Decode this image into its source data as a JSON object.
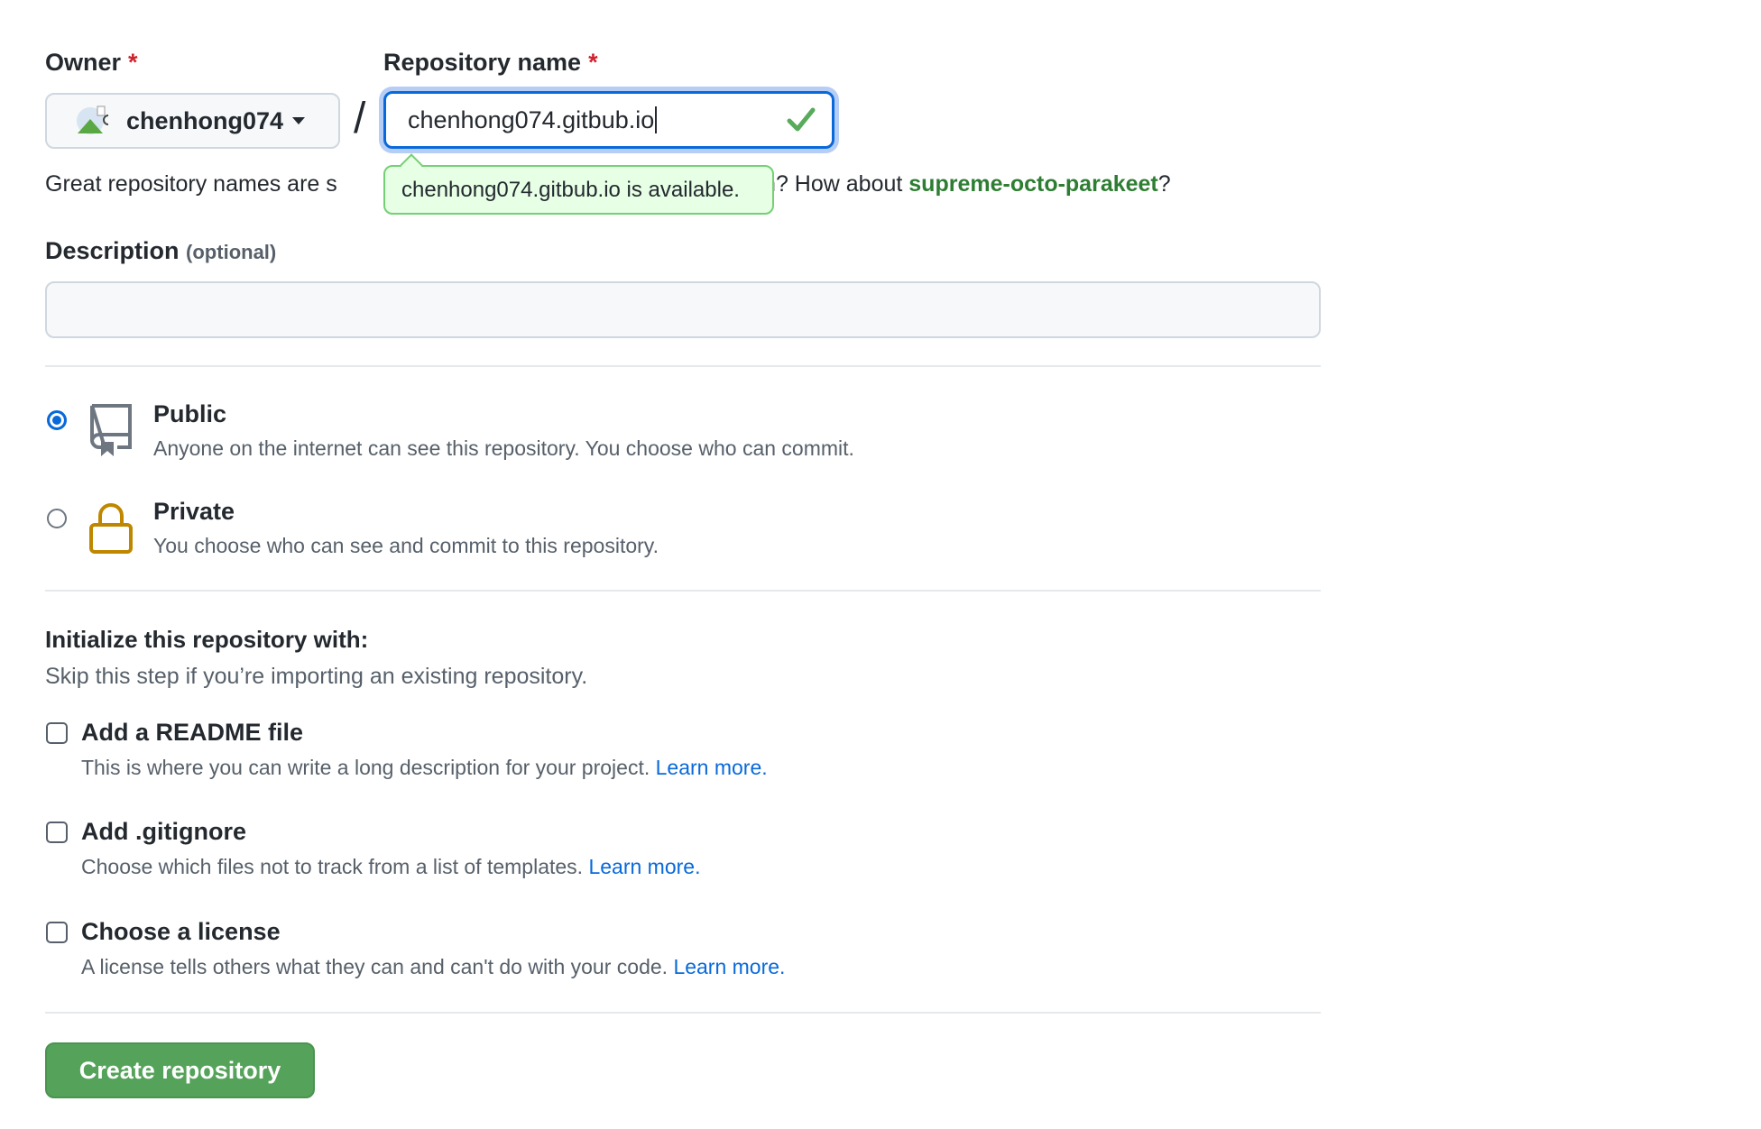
{
  "owner": {
    "label": "Owner",
    "required_mark": "*",
    "value": "chenhong074"
  },
  "repo": {
    "label": "Repository name",
    "required_mark": "*",
    "value": "chenhong074.gitbub.io",
    "status_icon": "check-icon",
    "tooltip": "chenhong074.gitbub.io is available."
  },
  "separator": "/",
  "help": {
    "prefix": "Great repository names are s",
    "middle": "ation? How about ",
    "suggestion": "supreme-octo-parakeet",
    "suffix": "?"
  },
  "description": {
    "label": "Description",
    "optional": "(optional)",
    "value": ""
  },
  "visibility": [
    {
      "title": "Public",
      "desc": "Anyone on the internet can see this repository. You choose who can commit.",
      "selected": true,
      "icon": "repo-icon"
    },
    {
      "title": "Private",
      "desc": "You choose who can see and commit to this repository.",
      "selected": false,
      "icon": "lock-icon"
    }
  ],
  "init": {
    "heading": "Initialize this repository with:",
    "sub": "Skip this step if you’re importing an existing repository.",
    "options": [
      {
        "title": "Add a README file",
        "desc": "This is where you can write a long description for your project. ",
        "link": "Learn more.",
        "checked": false
      },
      {
        "title": "Add .gitignore",
        "desc": "Choose which files not to track from a list of templates. ",
        "link": "Learn more.",
        "checked": false
      },
      {
        "title": "Choose a license",
        "desc": "A license tells others what they can and can't do with your code. ",
        "link": "Learn more.",
        "checked": false
      }
    ]
  },
  "create_label": "Create repository",
  "colors": {
    "accent": "#0969da",
    "success": "#55a35a",
    "required": "#cf222e",
    "lock": "#bf8700"
  }
}
